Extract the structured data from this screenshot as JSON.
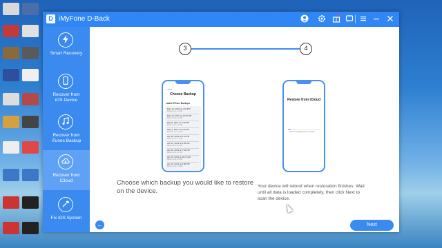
{
  "app": {
    "title": "iMyFone D-Back",
    "logo_letter": "D",
    "accent": "#2f86f4"
  },
  "titlebar_icons": [
    "user-icon",
    "gear-icon",
    "gift-icon",
    "feedback-icon",
    "menu-icon",
    "minimize-icon",
    "close-icon"
  ],
  "sidebar": {
    "items": [
      {
        "label": "Smart Recovery",
        "icon": "lightning-icon",
        "active": false
      },
      {
        "label": "Recover from\niOS Device",
        "icon": "phone-icon",
        "active": false
      },
      {
        "label": "Recover from\niTunes Backup",
        "icon": "music-icon",
        "active": false
      },
      {
        "label": "Recover from\niCloud",
        "icon": "cloud-icon",
        "active": true
      },
      {
        "label": "Fix iOS System",
        "icon": "wrench-icon",
        "active": false
      }
    ]
  },
  "steps": {
    "left": "3",
    "right": "4"
  },
  "phone_left": {
    "back": "< Back",
    "title": "Choose Backup",
    "subtitle": "Latest iPhone Backups",
    "backups": [
      {
        "date": "May 12, 2021 at 1:04 PM",
        "size": "Backup size 2.3 MB"
      },
      {
        "date": "May 10, 2021 at 10:30 PM",
        "size": "Backup size 4.1 MB"
      },
      {
        "date": "May 8, 2021 at 3:18 PM",
        "size": "Backup size 1.9 MB"
      },
      {
        "date": "May 5, 2021 at 8:42 AM",
        "size": "Backup size 3.0 MB"
      },
      {
        "date": "Apr 29, 2021 at 6:11 PM",
        "size": "Backup size 2.7 MB"
      },
      {
        "date": "Apr 25, 2021 at 9:05 AM",
        "size": "Backup size 5.2 MB"
      },
      {
        "date": "Apr 20, 2021 at 7:44 PM",
        "size": "Backup size 2.1 MB"
      },
      {
        "date": "Apr 15, 2021 at 11:27 AM",
        "size": "Backup size 3.6 MB"
      },
      {
        "date": "Apr 10, 2021 at 2:50 PM",
        "size": "Backup size 1.4 MB"
      }
    ]
  },
  "phone_right": {
    "title": "Restore from iCloud",
    "progress_fraction": 0.08,
    "progress_text": "Time remaining: About 1 minute"
  },
  "instructions": {
    "left": "Choose which backup you would like to restore on the device.",
    "right": "Your device will reboot when restoration finishes. Wait until all data is loaded completely, then click Next to scan the device."
  },
  "buttons": {
    "back_icon": "←",
    "next": "Next"
  },
  "desktop_icons": [
    "desktop-icon-1",
    "desktop-icon-2",
    "desktop-icon-3",
    "desktop-icon-4",
    "desktop-icon-5",
    "desktop-icon-6",
    "desktop-icon-7",
    "desktop-icon-8",
    "desktop-icon-9",
    "desktop-icon-10"
  ]
}
